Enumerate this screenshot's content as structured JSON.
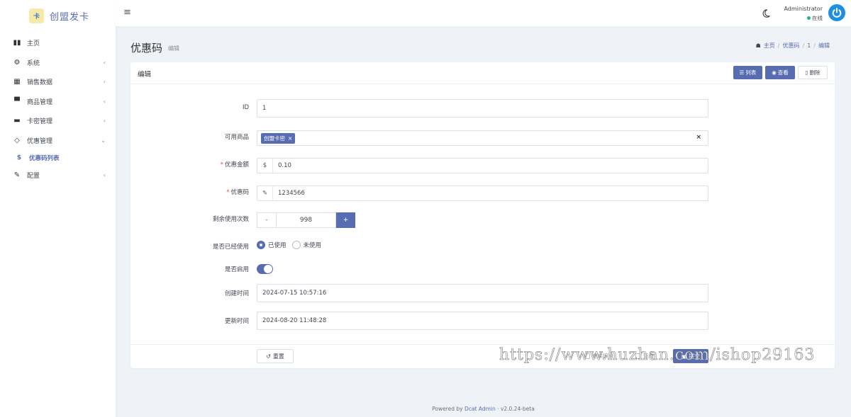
{
  "brand": {
    "logo_text": "卡",
    "name": "创盟发卡"
  },
  "sidebar": {
    "items": [
      {
        "label": "主页",
        "icon": "bar-chart-icon",
        "glyph": "▮▮"
      },
      {
        "label": "系统",
        "icon": "gear-icon",
        "glyph": "⚙",
        "chev": "‹"
      },
      {
        "label": "销售数据",
        "icon": "table-icon",
        "glyph": "▦",
        "chev": "‹"
      },
      {
        "label": "商品管理",
        "icon": "briefcase-icon",
        "glyph": "▀",
        "chev": "‹"
      },
      {
        "label": "卡密管理",
        "icon": "credit-card-icon",
        "glyph": "▬",
        "chev": "‹"
      },
      {
        "label": "优惠管理",
        "icon": "diamond-icon",
        "glyph": "◇",
        "chev": "⌄"
      }
    ],
    "subitem": {
      "label": "优惠码列表",
      "icon": "dollar-icon",
      "glyph": "$"
    },
    "config": {
      "label": "配置",
      "icon": "wrench-icon",
      "glyph": "✎",
      "chev": "‹"
    }
  },
  "topbar": {
    "menu_glyph": "≡",
    "user_name": "Administrator",
    "user_status": "在线"
  },
  "header": {
    "title": "优惠码",
    "subtitle": "编辑",
    "breadcrumb": {
      "home": "主页",
      "section": "优惠码",
      "id": "1",
      "current": "编辑",
      "sep": "/"
    }
  },
  "card": {
    "title": "编辑",
    "buttons": {
      "list": "列表",
      "view": "查看",
      "delete": "删除"
    }
  },
  "form": {
    "id": {
      "label": "ID",
      "value": "1"
    },
    "goods": {
      "label": "可用商品",
      "tag": "创盟卡密",
      "tag_x": "×",
      "clear": "×"
    },
    "amount": {
      "label": "优惠金额",
      "required": "*",
      "addon": "$",
      "value": "0.10"
    },
    "code": {
      "label": "优惠码",
      "required": "*",
      "addon": "✎",
      "value": "1234566"
    },
    "remaining": {
      "label": "剩余使用次数",
      "minus": "-",
      "value": "998",
      "plus": "+"
    },
    "used": {
      "label": "是否已经使用",
      "options": [
        "已使用",
        "未使用"
      ],
      "selected": "已使用"
    },
    "enabled": {
      "label": "是否启用",
      "value": true
    },
    "created": {
      "label": "创建时间",
      "value": "2024-07-15 10:57:16"
    },
    "updated": {
      "label": "更新时间",
      "value": "2024-08-20 11:48:28"
    }
  },
  "footer_actions": {
    "reset": "重置",
    "continue_edit": "继续编辑",
    "view": "查看",
    "submit": "提交"
  },
  "watermark": "https://www.huzhan.com/ishop29163",
  "footer": {
    "powered": "Powered by",
    "link": "Dcat Admin",
    "sep": "·",
    "version": "v2.0.24-beta"
  },
  "colors": {
    "primary": "#586cb1",
    "online": "#21b978",
    "avatar": "#1c8fe0",
    "required": "#e74c3c"
  }
}
